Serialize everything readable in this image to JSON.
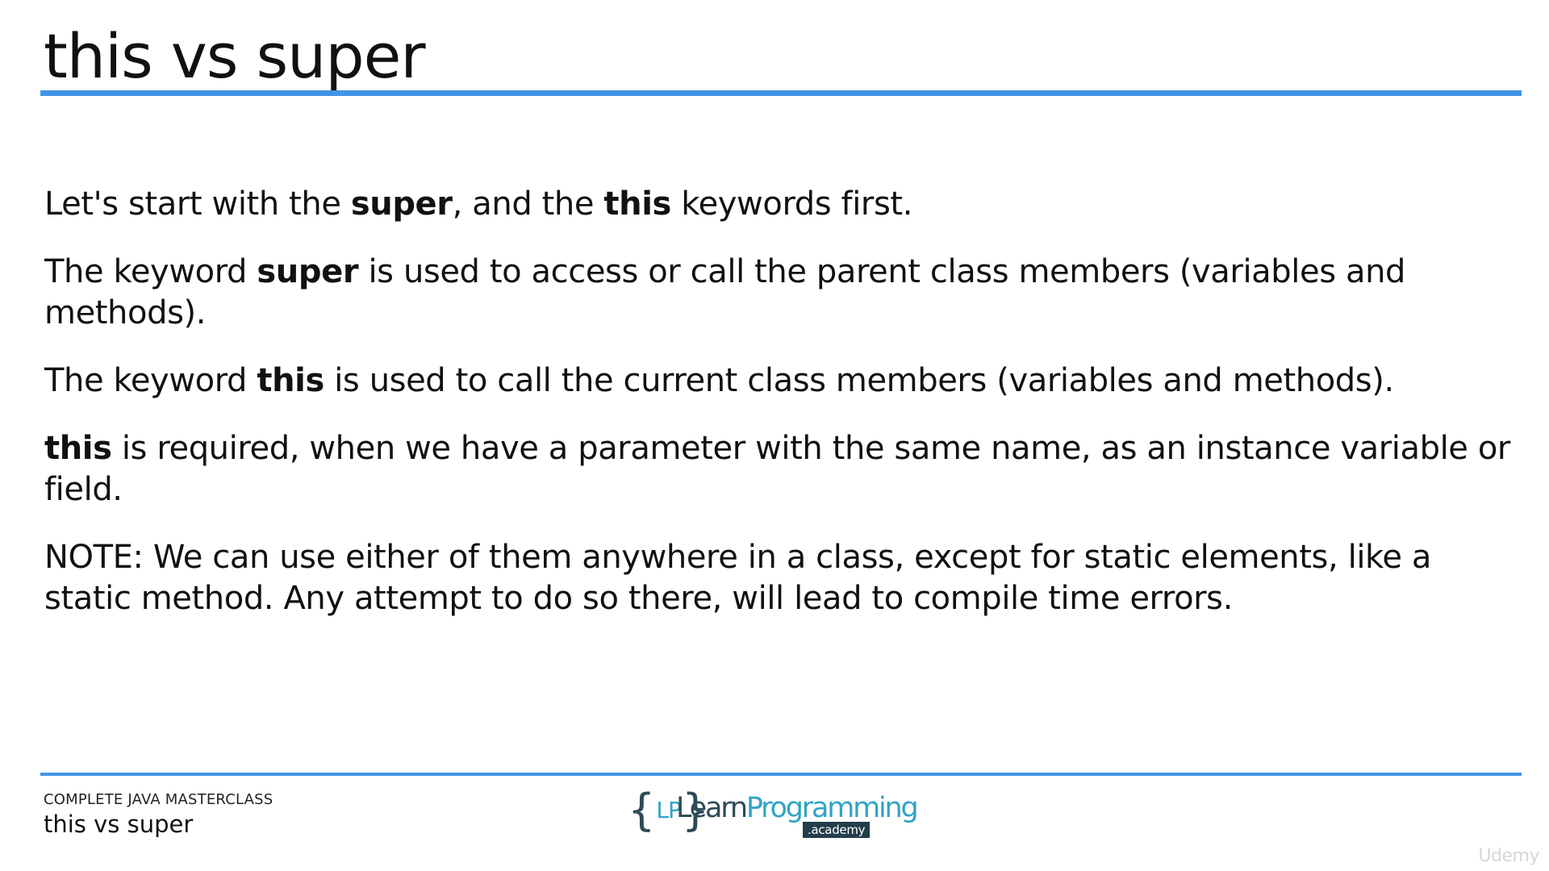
{
  "slide": {
    "title": "this vs super",
    "paragraphs": [
      [
        {
          "text": "Let's start with the ",
          "bold": false
        },
        {
          "text": "super",
          "bold": true
        },
        {
          "text": ", and the ",
          "bold": false
        },
        {
          "text": "this",
          "bold": true
        },
        {
          "text": " keywords first.",
          "bold": false
        }
      ],
      [
        {
          "text": "The keyword ",
          "bold": false
        },
        {
          "text": "super",
          "bold": true
        },
        {
          "text": " is used to access or call the parent class members (variables and methods).",
          "bold": false
        }
      ],
      [
        {
          "text": "The keyword ",
          "bold": false
        },
        {
          "text": "this",
          "bold": true
        },
        {
          "text": " is used to call the current class members (variables and methods).",
          "bold": false
        }
      ],
      [
        {
          "text": "this",
          "bold": true
        },
        {
          "text": " is required, when we have a parameter with the same name, as an instance variable or field.",
          "bold": false
        }
      ],
      [
        {
          "text": "NOTE: We can use either of them anywhere in a class, except for static elements, like a static method.  Any attempt to do so there, will lead to compile time errors.",
          "bold": false
        }
      ]
    ]
  },
  "footer": {
    "course_name": "COMPLETE JAVA MASTERCLASS",
    "subtitle": "this vs super"
  },
  "logo": {
    "brace_open": "{",
    "initials": "LP",
    "brace_close": "}",
    "word_a": "Learn",
    "word_b": "Programming",
    "academy": ".academy"
  },
  "watermark": "Udemy",
  "colors": {
    "accent_rule": "#3f95e3",
    "logo_dark": "#2e4a56",
    "logo_light": "#31a3c6"
  }
}
